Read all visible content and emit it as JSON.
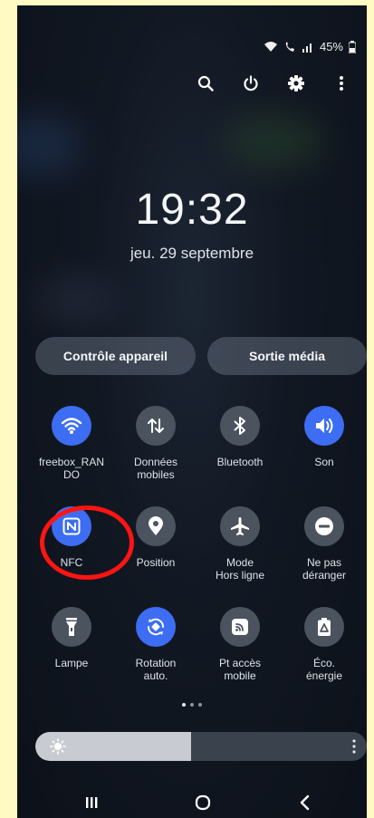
{
  "status": {
    "battery_text": "45%",
    "icons": [
      "wifi-icon",
      "wifi-calling-icon",
      "signal-icon",
      "battery-icon"
    ]
  },
  "top_actions": [
    "search-icon",
    "power-icon",
    "settings-icon",
    "more-vert-icon"
  ],
  "lock": {
    "time": "19:32",
    "date": "jeu. 29 septembre"
  },
  "buttons": {
    "device_control": "Contrôle appareil",
    "media_output": "Sortie média"
  },
  "tiles": [
    {
      "label": "freebox_RAN\nDO",
      "icon": "wifi-icon",
      "active": true
    },
    {
      "label": "Données\nmobiles",
      "icon": "mobile-data-icon",
      "active": false
    },
    {
      "label": "Bluetooth",
      "icon": "bluetooth-icon",
      "active": false
    },
    {
      "label": "Son",
      "icon": "sound-icon",
      "active": true
    },
    {
      "label": "NFC",
      "icon": "nfc-icon",
      "active": true
    },
    {
      "label": "Position",
      "icon": "location-icon",
      "active": false
    },
    {
      "label": "Mode\nHors ligne",
      "icon": "airplane-icon",
      "active": false
    },
    {
      "label": "Ne pas\ndéranger",
      "icon": "do-not-disturb-icon",
      "active": false
    },
    {
      "label": "Lampe",
      "icon": "flashlight-icon",
      "active": false
    },
    {
      "label": "Rotation\nauto.",
      "icon": "auto-rotate-icon",
      "active": true
    },
    {
      "label": "Pt accès\nmobile",
      "icon": "hotspot-icon",
      "active": false
    },
    {
      "label": "Éco.\nénergie",
      "icon": "power-saving-icon",
      "active": false
    }
  ],
  "pager": {
    "pages": 3,
    "current": 1
  },
  "brightness": {
    "level": 0.47
  },
  "nav": [
    "recents-icon",
    "home-icon",
    "back-icon"
  ],
  "colors": {
    "active_tile": "#3d6df2",
    "inactive_tile": "#4b535f",
    "highlight": "#ff1414"
  }
}
